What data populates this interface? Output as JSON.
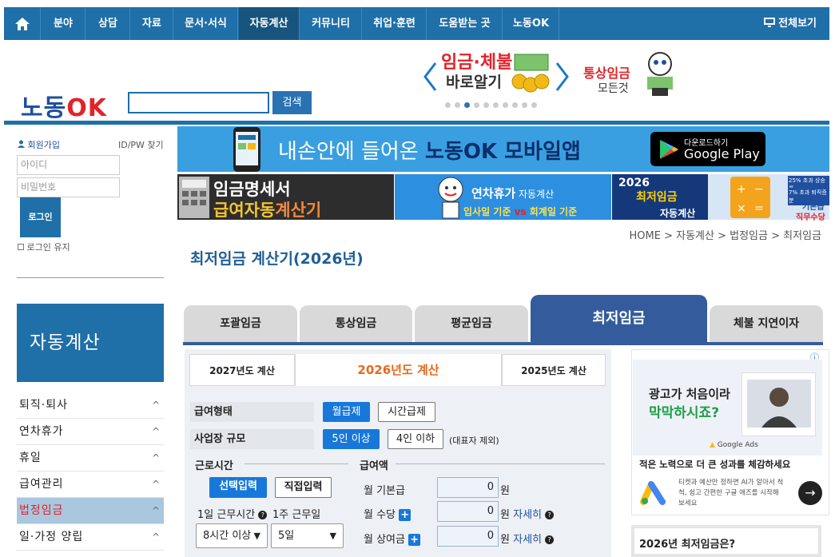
{
  "nav": {
    "items": [
      "분야",
      "상담",
      "자료",
      "문서·서식",
      "자동계산",
      "커뮤니티",
      "취업·훈련",
      "도움받는 곳",
      "노동OK"
    ],
    "active": "자동계산",
    "fullview": "전체보기"
  },
  "header": {
    "logo_a": "노동",
    "logo_b": "OK",
    "search_button": "검색",
    "banner1_line1": "임금·체불",
    "banner1_line2": "바로알기",
    "banner2_line1": "통상임금",
    "banner2_line2": "모든것"
  },
  "login": {
    "signup": "회원가입",
    "find": "ID/PW 찾기",
    "id_placeholder": "아이디",
    "pw_placeholder": "비밀번호",
    "login_button": "로그인",
    "keep": "로그인 유지"
  },
  "sidebar": {
    "title": "자동계산",
    "items": [
      "퇴직·퇴사",
      "연차휴가",
      "휴일",
      "급여관리",
      "법정임금",
      "일·가정 양립"
    ],
    "active_index": 4
  },
  "banners": {
    "mobile_text_a": "내손안에 들어온 ",
    "mobile_text_b": "노동OK",
    "mobile_text_c": " 모바일앱",
    "gp_small": "다운로드하기",
    "gp_big": "Google Play",
    "sub1_line1": "임금명세서",
    "sub1_line2a": "급여자동",
    "sub1_line2b": "계산기",
    "sub2_title": "연차휴가",
    "sub2_suffix": " 자동계산",
    "sub2_line2a": "입사일 기준",
    "sub2_vs": "vs",
    "sub2_line2b": "회계일 기준",
    "sub3_year": "2026",
    "sub3_line1": "최저임금",
    "sub3_line2": "자동계산",
    "sub4_top": "25% 초과 상승률",
    "sub4_mid": "7% 초과 퇴직증분",
    "sub4_a": "기본급",
    "sub4_b": "직무수당"
  },
  "breadcrumb": [
    "HOME",
    "자동계산",
    "법정임금",
    "최저임금"
  ],
  "page_title": "최저임금 계산기(2026년)",
  "tabs": [
    "포괄임금",
    "통상임금",
    "평균임금",
    "최저임금",
    "체불 지연이자"
  ],
  "active_tab": "최저임금",
  "year_tabs": [
    "2027년도 계산",
    "2026년도 계산",
    "2025년도 계산"
  ],
  "form": {
    "pay_type_label": "급여형태",
    "pay_type_options": [
      "월급제",
      "시간급제"
    ],
    "size_label": "사업장 규모",
    "size_options": [
      "5인 이상",
      "4인 이하"
    ],
    "size_note": "(대표자 제외)",
    "work_time_title": "근로시간",
    "mode_options": [
      "선택입력",
      "직접입력"
    ],
    "daily_hours_label": "1일 근무시간",
    "weekly_days_label": "1주 근무일",
    "daily_hours_value": "8시간 이상",
    "weekly_days_value": "5일",
    "pay_title": "급여액",
    "base_label": "월 기본급",
    "allowance_label": "월 수당",
    "bonus_label": "월 상여금",
    "base_value": "0",
    "allowance_value": "0",
    "bonus_value": "0",
    "unit": "원",
    "detail": "자세히"
  },
  "ad": {
    "headline1": "광고가 처음이라",
    "headline2": "막막하시죠?",
    "brand": "Google Ads",
    "tagline": "적은 노력으로 더 큰 성과를 체감하세요",
    "body": "티켓과 예산만 정하면 AI가 알아서 척척, 쉽고 간편한 구글 애즈를 시작해 보세요",
    "info_mark": "ⓘ",
    "next_arrow": "→"
  },
  "info_box": "2026년 최저임금은?",
  "colors": {
    "primary": "#1f6fa8",
    "tab_active": "#345c9c",
    "accent_orange": "#e8691e",
    "red": "#e2232a"
  }
}
